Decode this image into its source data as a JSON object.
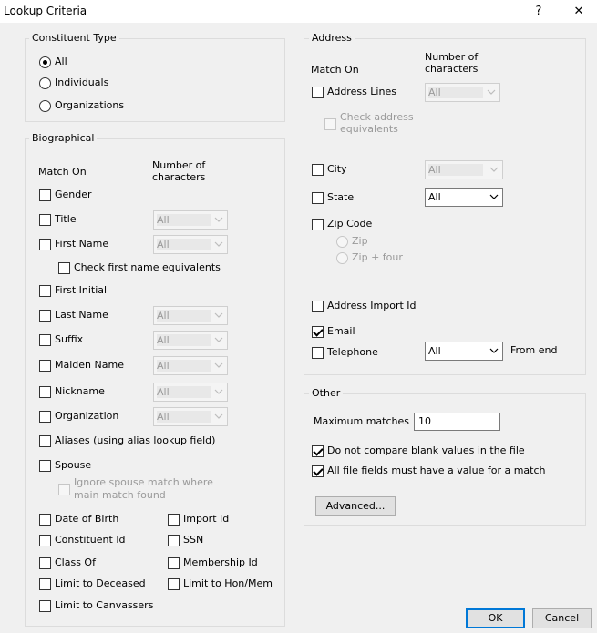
{
  "window": {
    "title": "Lookup Criteria",
    "help": "?",
    "close": "✕"
  },
  "constituent_type": {
    "legend": "Constituent Type",
    "options": [
      {
        "label": "All",
        "selected": true
      },
      {
        "label": "Individuals",
        "selected": false
      },
      {
        "label": "Organizations",
        "selected": false
      }
    ]
  },
  "biographical": {
    "legend": "Biographical",
    "match_on": "Match On",
    "num_chars_1": "Number of",
    "num_chars_2": "characters",
    "gender": "Gender",
    "title": "Title",
    "first_name": "First Name",
    "check_first_name_equivalents": "Check first name equivalents",
    "first_initial": "First Initial",
    "last_name": "Last Name",
    "suffix": "Suffix",
    "maiden_name": "Maiden Name",
    "nickname": "Nickname",
    "organization": "Organization",
    "aliases": "Aliases (using alias lookup field)",
    "spouse": "Spouse",
    "ignore_spouse_1": "Ignore spouse match where",
    "ignore_spouse_2": "main match found",
    "date_of_birth": "Date of Birth",
    "import_id": "Import Id",
    "constituent_id": "Constituent Id",
    "ssn": "SSN",
    "class_of": "Class Of",
    "membership_id": "Membership Id",
    "limit_deceased": "Limit to Deceased",
    "limit_honmem": "Limit to Hon/Mem",
    "limit_canvassers": "Limit to Canvassers",
    "select_value": "All"
  },
  "address": {
    "legend": "Address",
    "match_on": "Match On",
    "num_chars_1": "Number of",
    "num_chars_2": "characters",
    "address_lines": "Address Lines",
    "check_address_1": "Check address",
    "check_address_2": "equivalents",
    "city": "City",
    "state": "State",
    "zip_code": "Zip Code",
    "zip": "Zip",
    "zip_four": "Zip + four",
    "address_import_id": "Address Import Id",
    "email": "Email",
    "telephone": "Telephone",
    "from_end": "From end",
    "select_value": "All"
  },
  "other": {
    "legend": "Other",
    "max_matches_label": "Maximum matches",
    "max_matches_value": "10",
    "no_compare_blank": "Do not compare blank values in the file",
    "all_fields_value": "All file fields must have a value for a match",
    "advanced": "Advanced..."
  },
  "buttons": {
    "ok": "OK",
    "cancel": "Cancel"
  }
}
